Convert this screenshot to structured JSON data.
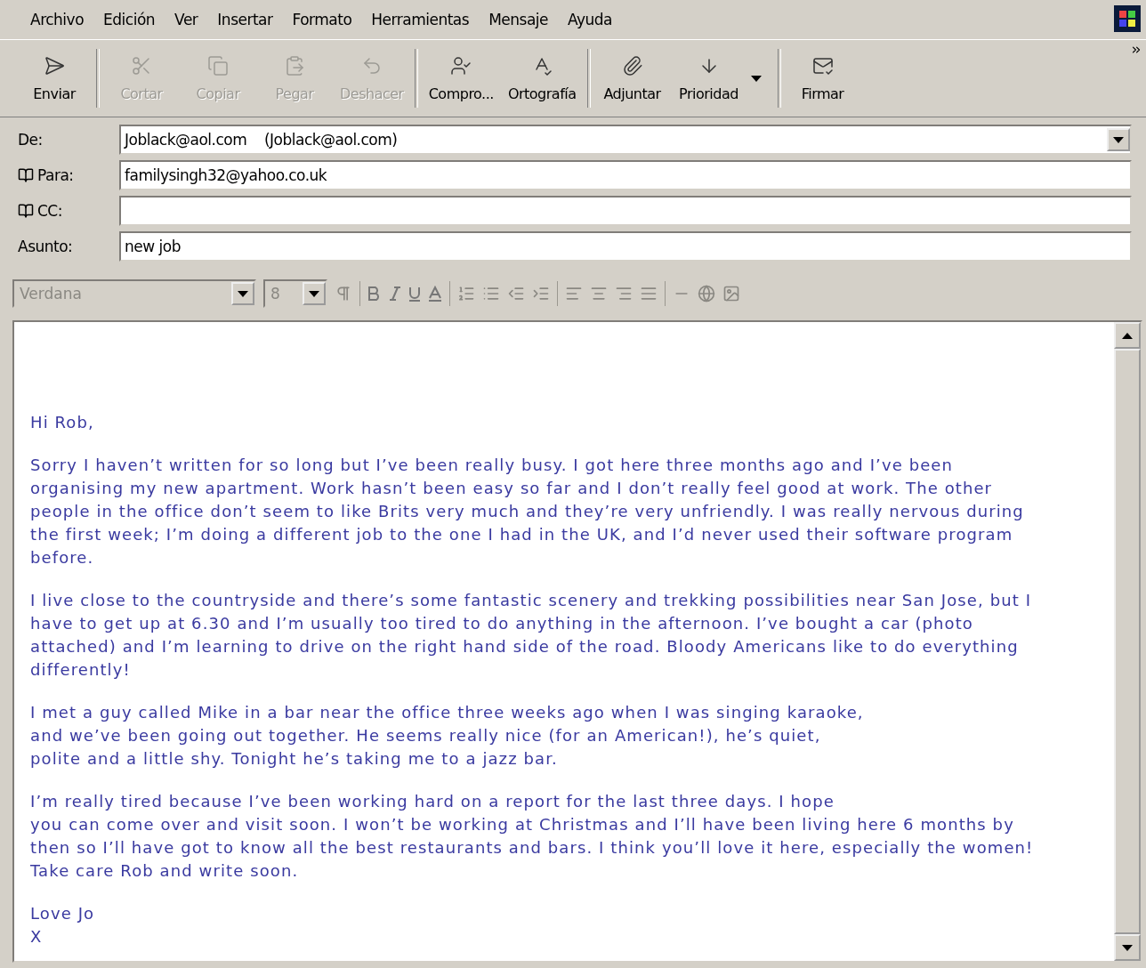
{
  "menu": [
    "Archivo",
    "Edición",
    "Ver",
    "Insertar",
    "Formato",
    "Herramientas",
    "Mensaje",
    "Ayuda"
  ],
  "toolbar": [
    {
      "label": "Enviar",
      "disabled": false
    },
    {
      "label": "Cortar",
      "disabled": true
    },
    {
      "label": "Copiar",
      "disabled": true
    },
    {
      "label": "Pegar",
      "disabled": true
    },
    {
      "label": "Deshacer",
      "disabled": true
    },
    {
      "label": "Compro...",
      "disabled": false
    },
    {
      "label": "Ortografía",
      "disabled": false
    },
    {
      "label": "Adjuntar",
      "disabled": false
    },
    {
      "label": "Prioridad",
      "disabled": false
    },
    {
      "label": "Firmar",
      "disabled": false
    }
  ],
  "fields": [
    {
      "label": "De:",
      "value": "Joblack@aol.com    (Joblack@aol.com)",
      "address_book": false,
      "dropdown": true
    },
    {
      "label": "Para:",
      "value": "familysingh32@yahoo.co.uk",
      "address_book": true,
      "dropdown": false
    },
    {
      "label": "CC:",
      "address_book": true,
      "dropdown": false
    },
    {
      "label": "Asunto:",
      "value": "new job",
      "address_book": false,
      "dropdown": false
    }
  ],
  "format_bar": {
    "font": "Verdana",
    "size": "8",
    "disabled": true
  },
  "body": [
    {
      "lines": [
        "Hi Rob,"
      ]
    },
    {
      "lines": [
        "Sorry I haven’t written for so long but I’ve been really busy. I got here three months ago and I’ve been",
        "organising my new apartment. Work hasn’t been easy so far and I don’t really feel good at work. The other",
        "people in the office don’t seem to like Brits very much and they’re very unfriendly. I was really nervous during",
        "the first week; I’m doing a different job to the one I had in the UK, and I’d never used their software program",
        "before."
      ]
    },
    {
      "lines": [
        "I live close to the countryside and there’s some fantastic scenery and trekking possibilities near San Jose, but I",
        "have to get up at 6.30 and I’m usually too tired to do anything in the afternoon. I’ve bought a car (photo",
        "attached) and I’m learning to drive on the right hand side of the road. Bloody Americans like to do everything",
        "differently!"
      ]
    },
    {
      "lines": [
        "I met a guy called Mike in a bar near the office three weeks ago when I was singing karaoke,",
        "and we’ve been going out together. He seems really nice (for an American!), he’s quiet,",
        "polite and a little shy. Tonight he’s taking me to a jazz bar."
      ]
    },
    {
      "lines": [
        "I’m really tired because I’ve been working hard on a report for the last three days. I hope",
        "you can come over and visit soon. I won’t be working at Christmas and I’ll have been living here 6 months by",
        "then so I’ll have got to know all the best restaurants and bars. I think you’ll love it here, especially the women!",
        "Take care Rob and write soon."
      ]
    },
    {
      "lines": [
        "Love Jo",
        "X"
      ]
    }
  ]
}
